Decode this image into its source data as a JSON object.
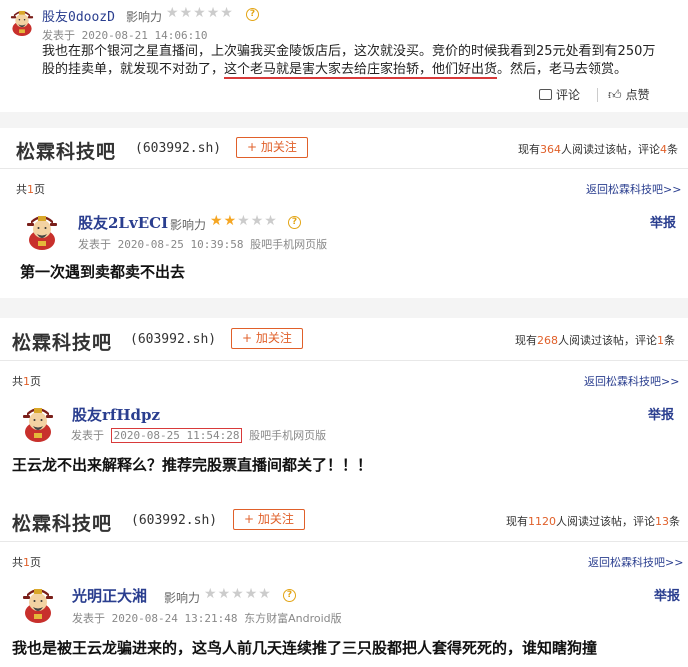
{
  "top_post": {
    "username": "股友0doozD",
    "influence_label": "影响力",
    "stars_on": 0,
    "posted_at": "发表于 2020-08-21 14:06:10",
    "text_line1": "我也在那个银河之星直播间，上次骗我买金陵饭店后，这次就没买。竞价的时候我看到25元处看到有250万",
    "text_line2_a": "股的挂卖单，就发现不对劲了，",
    "text_line2_b": "这个老马就是害大家去给庄家抬轿，他们好出货",
    "text_line2_c": "。然后，老马去领赏。",
    "reply_label": "评论",
    "like_label": "点赞"
  },
  "sections": [
    {
      "title": "松霖科技吧",
      "code": "(603992.sh)",
      "follow_label": "+ 加关注",
      "readers_prefix": "现有",
      "readers_count": "364",
      "readers_mid": "人阅读过该帖，评论",
      "comments_count": "4",
      "readers_suffix": "条",
      "total_prefix": "共",
      "total_pages": "1",
      "total_suffix": "页",
      "back_label": "返回松霖科技吧>>",
      "report_label": "举报",
      "post": {
        "username": "股友2LvECI",
        "influence_label": "影响力",
        "stars_on": 2,
        "posted_prefix": "发表于",
        "posted_time": "2020-08-25 10:39:58",
        "source": "股吧手机网页版",
        "text": "第一次遇到卖都卖不出去"
      }
    },
    {
      "title": "松霖科技吧",
      "code": "(603992.sh)",
      "follow_label": "+ 加关注",
      "readers_prefix": "现有",
      "readers_count": "268",
      "readers_mid": "人阅读过该帖，评论",
      "comments_count": "1",
      "readers_suffix": "条",
      "total_prefix": "共",
      "total_pages": "1",
      "total_suffix": "页",
      "back_label": "返回松霖科技吧>>",
      "report_label": "举报",
      "post": {
        "username": "股友rfHdpz",
        "posted_prefix": "发表于",
        "posted_time": "2020-08-25 11:54:28",
        "source": "股吧手机网页版",
        "text": "王云龙不出来解释么？推荐完股票直播间都关了！！！"
      }
    },
    {
      "title": "松霖科技吧",
      "code": "(603992.sh)",
      "follow_label": "+ 加关注",
      "readers_prefix": "现有",
      "readers_count": "1120",
      "readers_mid": "人阅读过该帖，评论",
      "comments_count": "13",
      "readers_suffix": "条",
      "total_prefix": "共",
      "total_pages": "1",
      "total_suffix": "页",
      "back_label": "返回松霖科技吧>>",
      "report_label": "举报",
      "post": {
        "username": "光明正大湘",
        "influence_label": "影响力",
        "stars_on": 0,
        "posted_prefix": "发表于",
        "posted_time": "2020-08-24 13:21:48",
        "source": "东方财富Android版",
        "text": "我也是被王云龙骗进来的，这鸟人前几天连续推了三只股都把人套得死死的，谁知瞎狗撞"
      }
    }
  ],
  "colors": {
    "accent": "#e0602a",
    "link": "#2a3e8f",
    "star_on": "#f5a623",
    "underline_red": "#d83a3a"
  }
}
